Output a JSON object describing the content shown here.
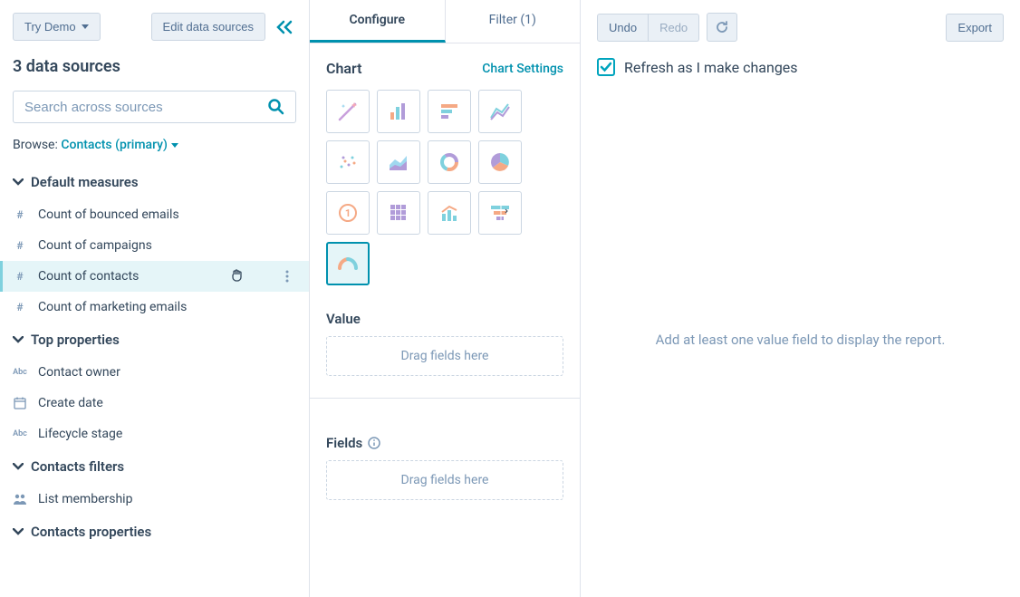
{
  "sidebar": {
    "try_demo": "Try Demo",
    "edit_sources": "Edit data sources",
    "source_count": "3 data sources",
    "search_placeholder": "Search across sources",
    "browse_label": "Browse:",
    "browse_value": "Contacts (primary)",
    "groups": [
      {
        "title": "Default measures",
        "items": [
          {
            "icon": "#",
            "label": "Count of bounced emails"
          },
          {
            "icon": "#",
            "label": "Count of campaigns"
          },
          {
            "icon": "#",
            "label": "Count of contacts",
            "active": true
          },
          {
            "icon": "#",
            "label": "Count of marketing emails"
          }
        ]
      },
      {
        "title": "Top properties",
        "items": [
          {
            "icon": "Abc",
            "label": "Contact owner"
          },
          {
            "icon": "date",
            "label": "Create date"
          },
          {
            "icon": "Abc",
            "label": "Lifecycle stage"
          }
        ]
      },
      {
        "title": "Contacts filters",
        "items": [
          {
            "icon": "people",
            "label": "List membership"
          }
        ]
      },
      {
        "title": "Contacts properties",
        "items": []
      }
    ]
  },
  "config": {
    "tabs": {
      "configure": "Configure",
      "filter": "Filter (1)"
    },
    "chart_label": "Chart",
    "chart_settings": "Chart Settings",
    "value_label": "Value",
    "fields_label": "Fields",
    "drag_hint": "Drag fields here",
    "chart_types": [
      "magic",
      "bar",
      "hbar",
      "line",
      "scatter",
      "area",
      "donut",
      "pie",
      "kpi",
      "pivot",
      "combo",
      "funnel",
      "gauge"
    ]
  },
  "preview": {
    "undo": "Undo",
    "redo": "Redo",
    "export": "Export",
    "refresh_label": "Refresh as I make changes",
    "empty_hint": "Add at least one value field to display the report."
  }
}
